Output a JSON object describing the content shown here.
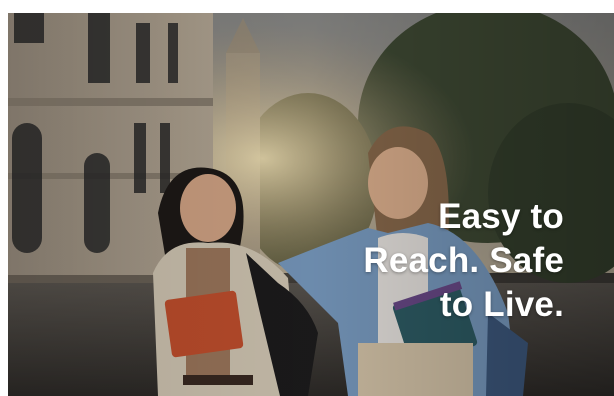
{
  "hero": {
    "tagline_line1": "Easy to",
    "tagline_line2": "Reach. Safe",
    "tagline_line3": "to Live."
  }
}
